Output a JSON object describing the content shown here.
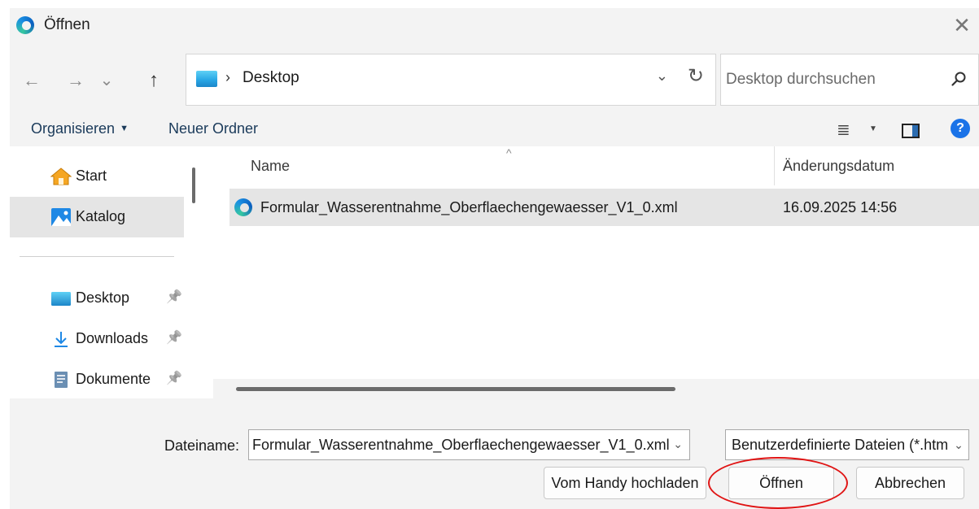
{
  "window": {
    "title": "Öffnen",
    "close_glyph": "✕"
  },
  "nav": {
    "back_glyph": "←",
    "forward_glyph": "→",
    "recent_glyph": "⌄",
    "up_glyph": "↑"
  },
  "address": {
    "separator": "›",
    "location": "Desktop",
    "dropdown_glyph": "⌄",
    "refresh_glyph": "↻"
  },
  "search": {
    "placeholder": "Desktop durchsuchen"
  },
  "toolbar": {
    "organize_label": "Organisieren",
    "organize_caret": "▼",
    "new_folder_label": "Neuer Ordner",
    "view_glyph": "≣",
    "view_caret": "▼",
    "help_glyph": "?"
  },
  "sidebar": {
    "items": [
      {
        "label": "Start",
        "icon": "home-icon",
        "pinned": false,
        "selected": false
      },
      {
        "label": "Katalog",
        "icon": "gallery-icon",
        "pinned": false,
        "selected": true
      },
      {
        "label": "Desktop",
        "icon": "desktop-folder-icon",
        "pinned": true,
        "selected": false
      },
      {
        "label": "Downloads",
        "icon": "download-icon",
        "pinned": true,
        "selected": false
      },
      {
        "label": "Dokumente",
        "icon": "document-icon",
        "pinned": true,
        "selected": false
      }
    ],
    "pin_glyph": "📌"
  },
  "filelist": {
    "sort_glyph": "^",
    "columns": {
      "name": "Name",
      "date": "Änderungsdatum"
    },
    "rows": [
      {
        "name": "Formular_Wasserentnahme_Oberflaechengewaesser_V1_0.xml",
        "date": "16.09.2025 14:56",
        "icon": "edge-file-icon"
      }
    ]
  },
  "bottom": {
    "filename_label": "Dateiname:",
    "filename_value": "Formular_Wasserentnahme_Oberflaechengewaesser_V1_0.xml",
    "filetype_value": "Benutzerdefinierte Dateien (*.htm",
    "caret_glyph": "⌄",
    "upload_button": "Vom Handy hochladen",
    "open_button": "Öffnen",
    "cancel_button": "Abbrechen"
  },
  "colors": {
    "accent": "#1a73e8",
    "highlight_annotation": "#e01414",
    "selection": "#e5e5e5"
  }
}
